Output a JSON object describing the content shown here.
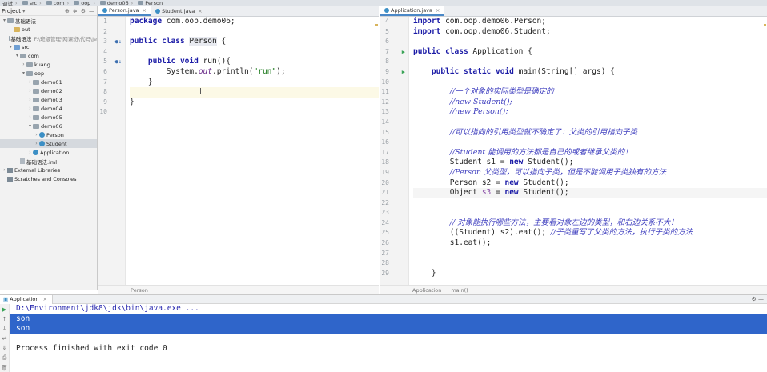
{
  "breadcrumbs": [
    "调试",
    "src",
    "com",
    "oop",
    "demo06",
    "Person"
  ],
  "project": {
    "label": "Project",
    "tree": [
      {
        "label": "基础语法",
        "depth": 0,
        "arrow": "▾",
        "icon": "grey"
      },
      {
        "label": "out",
        "depth": 1,
        "arrow": "",
        "icon": "yellow"
      },
      {
        "label": "基础语法",
        "sub": "F:\\班级管理\\网课班\\代码\\Je",
        "depth": 1,
        "arrow": "",
        "icon": "grey"
      },
      {
        "label": "src",
        "depth": 1,
        "arrow": "▾",
        "icon": "blue"
      },
      {
        "label": "com",
        "depth": 2,
        "arrow": "▾",
        "icon": "grey"
      },
      {
        "label": "kuang",
        "depth": 3,
        "arrow": "›",
        "icon": "grey"
      },
      {
        "label": "oop",
        "depth": 3,
        "arrow": "▾",
        "icon": "grey"
      },
      {
        "label": "demo01",
        "depth": 4,
        "arrow": "›",
        "icon": "grey"
      },
      {
        "label": "demo02",
        "depth": 4,
        "arrow": "›",
        "icon": "grey"
      },
      {
        "label": "demo03",
        "depth": 4,
        "arrow": "›",
        "icon": "grey"
      },
      {
        "label": "demo04",
        "depth": 4,
        "arrow": "›",
        "icon": "grey"
      },
      {
        "label": "demo05",
        "depth": 4,
        "arrow": "›",
        "icon": "grey"
      },
      {
        "label": "demo06",
        "depth": 4,
        "arrow": "▾",
        "icon": "grey"
      },
      {
        "label": "Person",
        "depth": 5,
        "arrow": "›",
        "icon": "class"
      },
      {
        "label": "Student",
        "depth": 5,
        "arrow": "›",
        "icon": "class",
        "selected": true
      },
      {
        "label": "Application",
        "depth": 4,
        "arrow": "›",
        "icon": "class"
      },
      {
        "label": "基础语法.iml",
        "depth": 2,
        "arrow": "",
        "icon": "file"
      },
      {
        "label": "External Libraries",
        "depth": 0,
        "arrow": "›",
        "icon": "lib"
      },
      {
        "label": "Scratches and Consoles",
        "depth": 0,
        "arrow": "",
        "icon": "lib"
      }
    ]
  },
  "left_editor": {
    "tabs": [
      {
        "label": "Person.java",
        "active": true
      },
      {
        "label": "Student.java",
        "active": false
      }
    ],
    "status": "Person",
    "gutter": [
      {
        "n": "1"
      },
      {
        "n": "2"
      },
      {
        "n": "3",
        "mark": "ov"
      },
      {
        "n": "4"
      },
      {
        "n": "5",
        "mark": "ov"
      },
      {
        "n": "6"
      },
      {
        "n": "7"
      },
      {
        "n": "8"
      },
      {
        "n": "9"
      },
      {
        "n": "10"
      }
    ],
    "lines": [
      "package com.oop.demo06;",
      "",
      "public class Person {",
      "",
      "    public void run(){",
      "        System.out.println(\"run\");",
      "    }",
      "",
      "}",
      ""
    ]
  },
  "right_editor": {
    "tabs": [
      {
        "label": "Application.java",
        "active": true
      }
    ],
    "status": [
      "Application",
      "main()"
    ],
    "gutter": [
      {
        "n": "4"
      },
      {
        "n": "5"
      },
      {
        "n": "6"
      },
      {
        "n": "7",
        "mark": "run"
      },
      {
        "n": "8"
      },
      {
        "n": "9",
        "mark": "run"
      },
      {
        "n": "10"
      },
      {
        "n": "11"
      },
      {
        "n": "12"
      },
      {
        "n": "13"
      },
      {
        "n": "14"
      },
      {
        "n": "15"
      },
      {
        "n": "16"
      },
      {
        "n": "17"
      },
      {
        "n": "18"
      },
      {
        "n": "19"
      },
      {
        "n": "20"
      },
      {
        "n": "21"
      },
      {
        "n": "22"
      },
      {
        "n": "23"
      },
      {
        "n": "24"
      },
      {
        "n": "25"
      },
      {
        "n": "26"
      },
      {
        "n": "27"
      },
      {
        "n": "28"
      },
      {
        "n": "29"
      }
    ],
    "lines": [
      "import com.oop.demo06.Person;",
      "import com.oop.demo06.Student;",
      "",
      "public class Application {",
      "",
      "    public static void main(String[] args) {",
      "",
      "        //一个对象的实际类型是确定的",
      "        //new Student();",
      "        //new Person();",
      "",
      "        //可以指向的引用类型就不确定了：父类的引用指向子类",
      "",
      "        //Student 能调用的方法都是自己的或者继承父类的！",
      "        Student s1 = new Student();",
      "        //Person 父类型，可以指向子类，但是不能调用子类独有的方法",
      "        Person s2 = new Student();",
      "        Object s3 = new Student();",
      "",
      "",
      "        // 对象能执行哪些方法，主要看对象左边的类型，和右边关系不大！",
      "        ((Student) s2).eat(); //子类重写了父类的方法，执行子类的方法",
      "        s1.eat();",
      "",
      "",
      "    }"
    ]
  },
  "run_panel": {
    "tab_label": "Application",
    "lines": [
      "D:\\Environment\\jdk8\\jdk\\bin\\java.exe ...",
      "son",
      "son",
      "",
      "Process finished with exit code 0"
    ]
  }
}
